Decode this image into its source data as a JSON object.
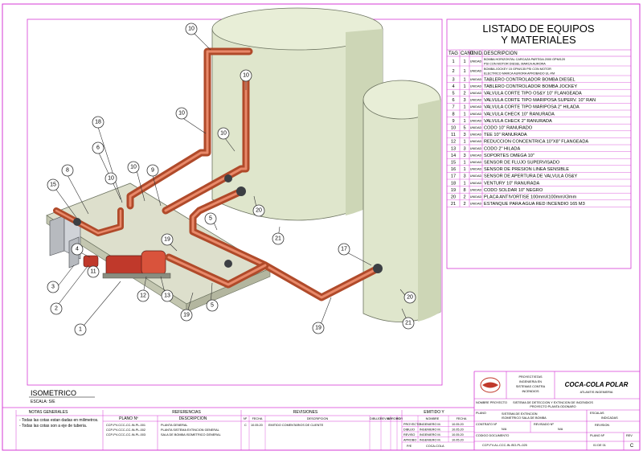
{
  "listado": {
    "title_line1": "LISTADO DE EQUIPOS",
    "title_line2": "Y MATERIALES",
    "headers": {
      "tag": "TAG",
      "cant": "CANT.",
      "unid": "UNID.",
      "desc": "DESCRIPCION"
    },
    "rows": [
      {
        "tag": "1",
        "cant": "1",
        "unid": "UNIDAD",
        "desc": [
          "BOMBA HORIZONTAL CARCAZA PARTIDA 2000 GPM/120",
          "PSI CON MOTOR DIESEL MARCA AURORA"
        ]
      },
      {
        "tag": "2",
        "cant": "1",
        "unid": "UNIDAD",
        "desc": [
          "BOMBA JOCKEY 15 GPM/135 PSI CON MOTOR",
          "ELECTRICO MARCA AURORA APROBADO UL-FM"
        ]
      },
      {
        "tag": "3",
        "cant": "1",
        "unid": "UNIDAD",
        "desc": [
          "TABLERO CONTROLADOR BOMBA DIESEL"
        ]
      },
      {
        "tag": "4",
        "cant": "1",
        "unid": "UNIDAD",
        "desc": [
          "TABLERO CONTROLADOR BOMBA JOCKEY"
        ]
      },
      {
        "tag": "5",
        "cant": "2",
        "unid": "UNIDAD",
        "desc": [
          "VALVULA CORTE TIPO OS&Y 10\" FLANGEADA"
        ]
      },
      {
        "tag": "6",
        "cant": "3",
        "unid": "UNIDAD",
        "desc": [
          "VALVULA CORTE TIPO MARIPOSA SUPERV. 10\" RAN"
        ]
      },
      {
        "tag": "7",
        "cant": "1",
        "unid": "UNIDAD",
        "desc": [
          "VALVULA CORTE TIPO MARIPOSA 2\" HILADA"
        ]
      },
      {
        "tag": "8",
        "cant": "1",
        "unid": "UNIDAD",
        "desc": [
          "VALVULA CHECK 10\" RANURADA"
        ]
      },
      {
        "tag": "9",
        "cant": "1",
        "unid": "UNIDAD",
        "desc": [
          "VALVULA CHECK 2\" RANURADA"
        ]
      },
      {
        "tag": "10",
        "cant": "5",
        "unid": "UNIDAD",
        "desc": [
          "CODO 10\" RANURADO"
        ]
      },
      {
        "tag": "11",
        "cant": "3",
        "unid": "UNIDAD",
        "desc": [
          "TEE 10\" RANURADA"
        ]
      },
      {
        "tag": "12",
        "cant": "1",
        "unid": "UNIDAD",
        "desc": [
          "REDUCCION CONCENTRICA 10\"X8\" FLANGEADA"
        ]
      },
      {
        "tag": "13",
        "cant": "3",
        "unid": "UNIDAD",
        "desc": [
          "CODO 2\" HILADA"
        ]
      },
      {
        "tag": "14",
        "cant": "3",
        "unid": "UNIDAD",
        "desc": [
          "SOPORTES OMEGA 10\""
        ]
      },
      {
        "tag": "15",
        "cant": "1",
        "unid": "UNIDAD",
        "desc": [
          "SENSOR DE FLUJO SUPERVISADO"
        ]
      },
      {
        "tag": "16",
        "cant": "1",
        "unid": "UNIDAD",
        "desc": [
          "SENSOR DE PRESION LINEA SENSIBLE"
        ]
      },
      {
        "tag": "17",
        "cant": "3",
        "unid": "UNIDAD",
        "desc": [
          "SENSOR DE APERTURA DE VALVULA OS&Y"
        ]
      },
      {
        "tag": "18",
        "cant": "1",
        "unid": "UNIDAD",
        "desc": [
          "VENTURY 10\" RANURADA"
        ]
      },
      {
        "tag": "19",
        "cant": "8",
        "unid": "UNIDAD",
        "desc": [
          "CODO SOLDAR 10\" NEGRO"
        ]
      },
      {
        "tag": "20",
        "cant": "2",
        "unid": "UNIDAD",
        "desc": [
          "PLACA ANTIVORTISE 100mmX100mmX3mm"
        ]
      },
      {
        "tag": "21",
        "cant": "2",
        "unid": "UNIDAD",
        "desc": [
          "ESTANQUE PARA AGUA RED INCENDIO 165 M3"
        ]
      }
    ]
  },
  "isometric": {
    "title": "ISOMETRICO",
    "scale": "ESCALA: S/E"
  },
  "bubbles": {
    "b10a": "10",
    "b10b": "10",
    "b10c": "10",
    "b10d": "10",
    "b10e": "10",
    "b10f": "10",
    "b18": "18",
    "b6": "6",
    "b15": "15",
    "b11": "11",
    "b3": "3",
    "b2": "2",
    "b1": "1",
    "b12": "12",
    "b13": "13",
    "b19a": "19",
    "b19b": "19",
    "b19c": "19",
    "b5a": "5",
    "b5b": "5",
    "b20a": "20",
    "b20b": "20",
    "b21a": "21",
    "b21b": "21",
    "b17": "17",
    "b9": "9",
    "b4": "4",
    "b8": "8"
  },
  "titleblock": {
    "client": "COCA-COLA POLAR",
    "client_sub": "ATLANTIS INGENIERIA",
    "company": [
      "PROYECTISTAS",
      "INGENIERIA EN",
      "SISTEMAS CONTRA",
      "INCENDIOS"
    ],
    "project_label": "NOMBRE PROYECTO",
    "project": [
      "SISTEMA DE DETECCION Y EXTINCION DE INCENDIOS",
      "PROYECTO PLANTA ODONARO"
    ],
    "sheet_label": "PLANO",
    "sheet": [
      "SISTEMA DE EXTINCION",
      "ISOMETRICO SALA DE BOMBA"
    ],
    "drawn_label": "CONTRATO Nº",
    "date_label": "REVISADO Nº",
    "na": "N/A",
    "scale_label": "ESCALAS",
    "scale_val": "INDICADAS",
    "code_label": "CODIGO DOCUMENTO",
    "code": "CCP-FV-AL-CCC-IN-ISO-PL-025",
    "plano_label": "PLANO Nº",
    "plano": "01 DE 01",
    "rev_label": "REV",
    "rev": "C"
  },
  "notes": {
    "header": "NOTAS GENERALES",
    "lines": [
      "- Todas las cotas estan dadas en milimetros.",
      "- Todas las cotas son a eje de tuberia."
    ]
  },
  "references": {
    "header": "REFERENCIAS",
    "col_plano": "PLANO Nº",
    "col_desc": "DESCRIPCION",
    "rows": [
      {
        "plano": "CCP-PV-CCC-CC-IN-PL-001",
        "desc": "PLANTA GENERAL"
      },
      {
        "plano": "CCP-PV-CCC-CC-IN-PL-002",
        "desc": "PLANTA SISTEMA EXTINCION GENERAL"
      },
      {
        "plano": "CCP-PV-CCC-CC-IN-PL-003",
        "desc": "SALA DE BOMBA ISOMETRICO GENERAL"
      }
    ]
  },
  "revisions": {
    "header": "REVISIONES",
    "cols": [
      "Nº",
      "FECHA",
      "DESCRIPCION",
      "DIBUJO",
      "REVISO",
      "APROBO",
      "POR"
    ],
    "rows": [
      {
        "n": "C",
        "fecha": "10.05.20",
        "desc": "EMITIDO COMENTARIOS DE CLIENTE"
      }
    ],
    "emitido_header": "EMITIDO Y",
    "emitido_cols": [
      "NOMBRE",
      "FECHA"
    ],
    "emitido_rows": [
      {
        "label": "PROYECTO",
        "nombre": "INGENIERO M.",
        "fecha": "10.05.20"
      },
      {
        "label": "DIBUJO",
        "nombre": "INGENIERO M.",
        "fecha": "10.05.20"
      },
      {
        "label": "REVISO",
        "nombre": "INGENIERO M.",
        "fecha": "10.05.20"
      },
      {
        "label": "APROBO",
        "nombre": "INGENIERO M.",
        "fecha": "10.05.20"
      }
    ],
    "footer_code": "COCA-COLA",
    "footer_no": "P/E",
    "revision_label": "REVISION"
  }
}
